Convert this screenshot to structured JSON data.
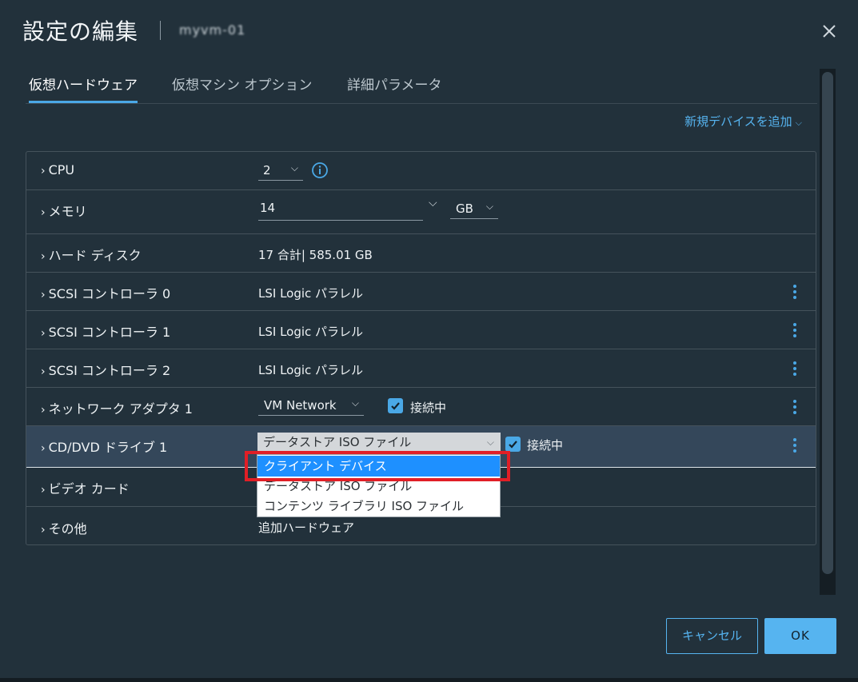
{
  "dialog": {
    "title": "設定の編集",
    "vm_name": "myvm-01",
    "close_icon": "close-icon"
  },
  "tabs": [
    {
      "label": "仮想ハードウェア",
      "active": true
    },
    {
      "label": "仮想マシン オプション",
      "active": false
    },
    {
      "label": "詳細パラメータ",
      "active": false
    }
  ],
  "add_device": {
    "label": "新規デバイスを追加",
    "icon": "chevron-down-icon"
  },
  "rows": {
    "cpu": {
      "label": "CPU",
      "value": "2"
    },
    "memory": {
      "label": "メモリ",
      "value": "14",
      "unit": "GB"
    },
    "disk": {
      "label": "ハード ディスク",
      "value": "17 合計| 585.01 GB"
    },
    "scsi0": {
      "label": "SCSI コントローラ 0",
      "value": "LSI Logic パラレル"
    },
    "scsi1": {
      "label": "SCSI コントローラ 1",
      "value": "LSI Logic パラレル"
    },
    "scsi2": {
      "label": "SCSI コントローラ 2",
      "value": "LSI Logic パラレル"
    },
    "network": {
      "label": "ネットワーク アダプタ 1",
      "value": "VM Network",
      "connected_label": "接続中",
      "connected": true
    },
    "cddvd": {
      "label": "CD/DVD ドライブ 1",
      "value": "データストア ISO ファイル",
      "connected_label": "接続中",
      "connected": true
    },
    "video": {
      "label": "ビデオ カード"
    },
    "other": {
      "label": "その他",
      "value": "追加ハードウェア"
    }
  },
  "dropdown": {
    "options": [
      {
        "label": "クライアント デバイス",
        "highlighted": true
      },
      {
        "label": "データストア ISO ファイル",
        "highlighted": false
      },
      {
        "label": "コンテンツ ライブラリ ISO ファイル",
        "highlighted": false
      }
    ]
  },
  "buttons": {
    "cancel": "キャンセル",
    "ok": "OK"
  },
  "colors": {
    "accent": "#56b4f0",
    "highlight_box": "#e11f26",
    "option_highlight": "#1e90ff"
  }
}
